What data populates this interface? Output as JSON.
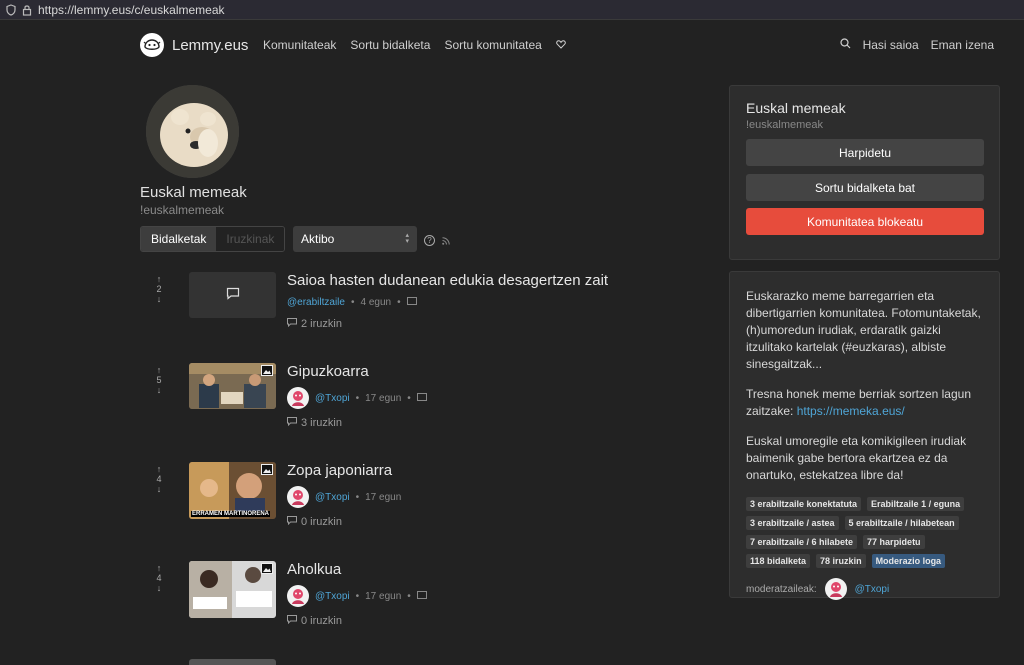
{
  "browser": {
    "url": "https://lemmy.eus/c/euskalmemeak"
  },
  "nav": {
    "brand": "Lemmy.eus",
    "links": [
      "Komunitateak",
      "Sortu bidalketa",
      "Sortu komunitatea"
    ],
    "right": {
      "login": "Hasi saioa",
      "signup": "Eman izena"
    }
  },
  "community": {
    "title": "Euskal memeak",
    "name": "!euskalmemeak",
    "tabs": [
      "Bidalketak",
      "Iruzkinak"
    ],
    "sort": "Aktibo"
  },
  "posts": [
    {
      "title": "Saioa hasten dudanean edukia desagertzen zait",
      "score": "2",
      "user": "@erabiltzaile",
      "time": "4 egun",
      "comments": "2 iruzkin"
    },
    {
      "title": "Gipuzkoarra",
      "score": "5",
      "user": "@Txopi",
      "time": "17 egun",
      "comments": "3 iruzkin"
    },
    {
      "title": "Zopa japoniarra",
      "score": "4",
      "user": "@Txopi",
      "time": "17 egun",
      "comments": "0 iruzkin",
      "thumb_text": "ERRAMEN MARTINORENA"
    },
    {
      "title": "Aholkua",
      "score": "4",
      "user": "@Txopi",
      "time": "17 egun",
      "comments": "0 iruzkin"
    }
  ],
  "sidebar": {
    "title": "Euskal memeak",
    "name": "!euskalmemeak",
    "subscribe": "Harpidetu",
    "create_post": "Sortu bidalketa bat",
    "block": "Komunitatea blokeatu",
    "desc1": "Euskarazko meme barregarrien eta dibertigarrien komunitatea. Fotomuntaketak, (h)umoredun irudiak, erdaratik gaizki itzulitako kartelak (#euzkaras), albiste sinesgaitzak...",
    "desc2_prefix": "Tresna honek meme berriak sortzen lagun zaitzake: ",
    "desc2_link": "https://memeka.eus/",
    "desc3": "Euskal umoregile eta komikigileen irudiak baimenik gabe bertora ekartzea ez da onartuko, estekatzea libre da!",
    "badges": [
      "3 erabiltzaile konektatuta",
      "Erabiltzaile 1 / eguna",
      "3 erabiltzaile / astea",
      "5 erabiltzaile / hilabetean",
      "7 erabiltzaile / 6 hilabete",
      "77 harpidetu",
      "118 bidalketa",
      "78 iruzkin",
      "Moderazio loga"
    ],
    "moderators_label": "moderatzaileak:",
    "moderator": "@Txopi"
  },
  "colors": {
    "bg": "#222222",
    "card": "#2d2d2d",
    "danger": "#e74c3c",
    "link": "#4fa5d6",
    "badge_blue": "#375a7f"
  }
}
